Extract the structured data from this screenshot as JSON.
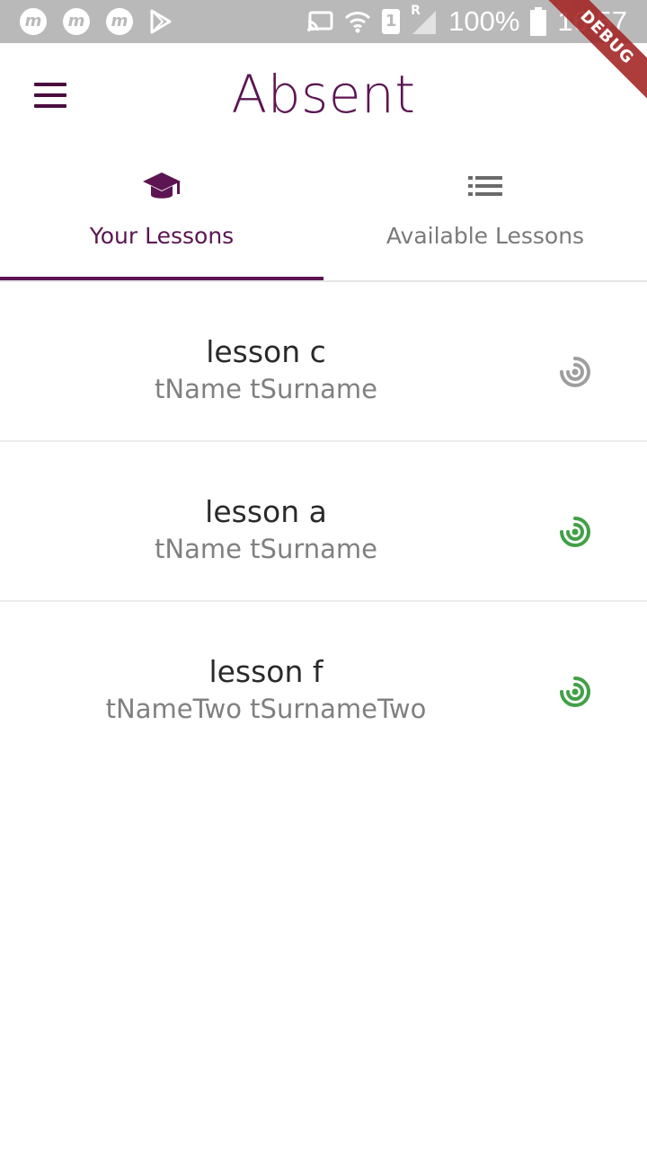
{
  "status_bar": {
    "notification_icons": [
      "m-app-icon",
      "m-app-icon",
      "m-app-icon",
      "play-store-icon"
    ],
    "sim_slot": "1",
    "roaming": "R",
    "battery_percent": "100%",
    "time": "16:57",
    "debug_banner": "DEBUG"
  },
  "app_bar": {
    "title": "Absent",
    "menu_icon": "hamburger-menu-icon"
  },
  "tabs": [
    {
      "label": "Your Lessons",
      "icon": "school-icon",
      "selected": true
    },
    {
      "label": "Available Lessons",
      "icon": "list-icon",
      "selected": false
    }
  ],
  "lessons": [
    {
      "name": "lesson c",
      "teacher": "tName tSurname",
      "status_icon": "radar-icon",
      "status_color": "#9e9e9e"
    },
    {
      "name": "lesson a",
      "teacher": "tName tSurname",
      "status_icon": "radar-icon",
      "status_color": "#43a047"
    },
    {
      "name": "lesson f",
      "teacher": "tNameTwo tSurnameTwo",
      "status_icon": "radar-icon",
      "status_color": "#43a047"
    }
  ],
  "colors": {
    "primary": "#5c1552",
    "status_bar": "#b9b9b9",
    "inactive_text": "#7a7a7a",
    "active_status": "#43a047",
    "inactive_status": "#9e9e9e"
  }
}
